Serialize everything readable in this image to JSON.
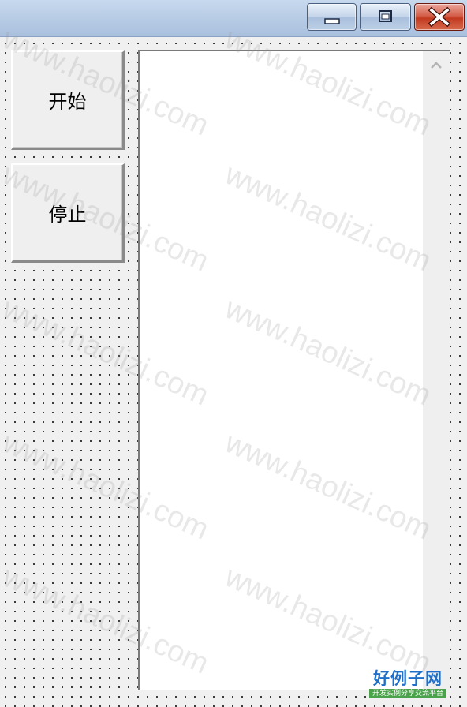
{
  "window": {
    "controls": {
      "minimize_icon": "minimize-icon",
      "maximize_icon": "maximize-icon",
      "close_icon": "close-icon"
    }
  },
  "buttons": {
    "start_label": "开始",
    "stop_label": "停止"
  },
  "listbox": {
    "items": [],
    "scroll_up_icon": "chevron-up-icon"
  },
  "watermark": {
    "text": "www.haolizi.com"
  },
  "logo": {
    "title": "好例子网",
    "subtitle": "开发实例分享交流平台"
  },
  "colors": {
    "titlebar": "#b9cde6",
    "close_button": "#c23a20",
    "logo_blue": "#1f6fc9",
    "logo_green": "#4aa34a"
  }
}
